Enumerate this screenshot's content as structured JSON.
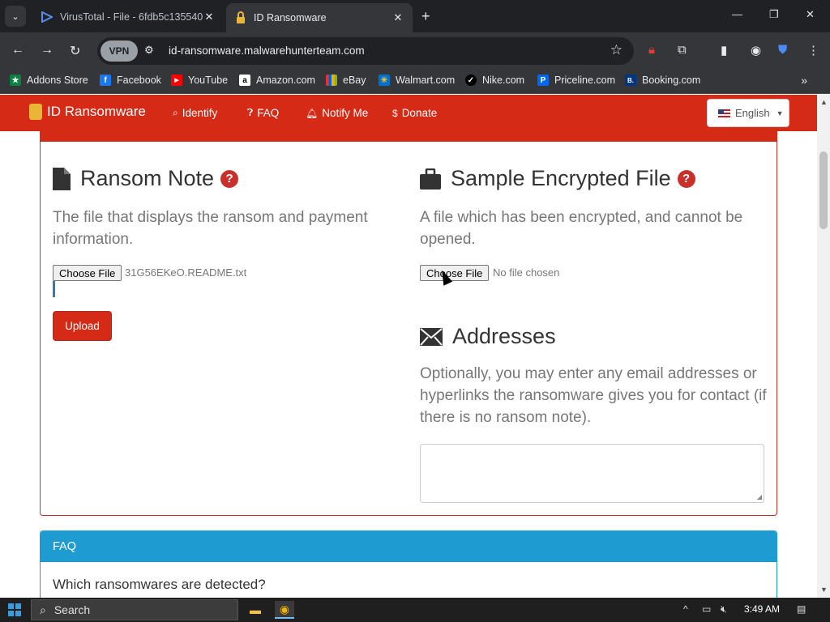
{
  "browser": {
    "tabs": [
      {
        "title": "VirusTotal - File - 6fdb5c135540",
        "favicon": "virustotal-icon"
      },
      {
        "title": "ID Ransomware",
        "favicon": "lock-icon"
      }
    ],
    "new_tab": "+",
    "window_controls": [
      "—",
      "❐",
      "✕"
    ],
    "vpn_label": "VPN",
    "url": "id-ransomware.malwarehunterteam.com"
  },
  "bookmarks": [
    {
      "label": "Addons Store",
      "color": "#0b8043",
      "glyph": "★"
    },
    {
      "label": "Facebook",
      "color": "#1877f2",
      "glyph": "f"
    },
    {
      "label": "YouTube",
      "color": "#ff0000",
      "glyph": "▶"
    },
    {
      "label": "Amazon.com",
      "color": "#ffffff",
      "glyph": "a"
    },
    {
      "label": "eBay",
      "color": "#e53238",
      "glyph": "e"
    },
    {
      "label": "Walmart.com",
      "color": "#0071ce",
      "glyph": "✳"
    },
    {
      "label": "Nike.com",
      "color": "#000000",
      "glyph": "✓"
    },
    {
      "label": "Priceline.com",
      "color": "#0068ef",
      "glyph": "P"
    },
    {
      "label": "Booking.com",
      "color": "#003580",
      "glyph": "B."
    }
  ],
  "site": {
    "brand": "ID Ransomware",
    "nav": [
      {
        "icon": "search-icon",
        "glyph": "🔍︎",
        "label": "Identify"
      },
      {
        "icon": "question-icon",
        "glyph": "?",
        "label": "FAQ"
      },
      {
        "icon": "bell-icon",
        "glyph": "🔔︎",
        "label": "Notify Me"
      },
      {
        "icon": "dollar-icon",
        "glyph": "$",
        "label": "Donate"
      }
    ],
    "language": "English",
    "accent": "#d42a16"
  },
  "ransom_note": {
    "title": "Ransom Note",
    "description": "The file that displays the ransom and payment information.",
    "choose_label": "Choose File",
    "file_name": "31G56EKeO.README.txt",
    "upload_label": "Upload"
  },
  "sample_file": {
    "title": "Sample Encrypted File",
    "description": "A file which has been encrypted, and cannot be opened.",
    "choose_label": "Choose File",
    "file_name": "No file chosen"
  },
  "addresses": {
    "title": "Addresses",
    "description": "Optionally, you may enter any email addresses or hyperlinks the ransomware gives you for contact (if there is no ransom note).",
    "value": ""
  },
  "faq": {
    "header": "FAQ",
    "question": "Which ransomwares are detected?",
    "accent": "#1e9bd1"
  },
  "taskbar": {
    "search_label": "Search",
    "time": "3:49 AM"
  }
}
